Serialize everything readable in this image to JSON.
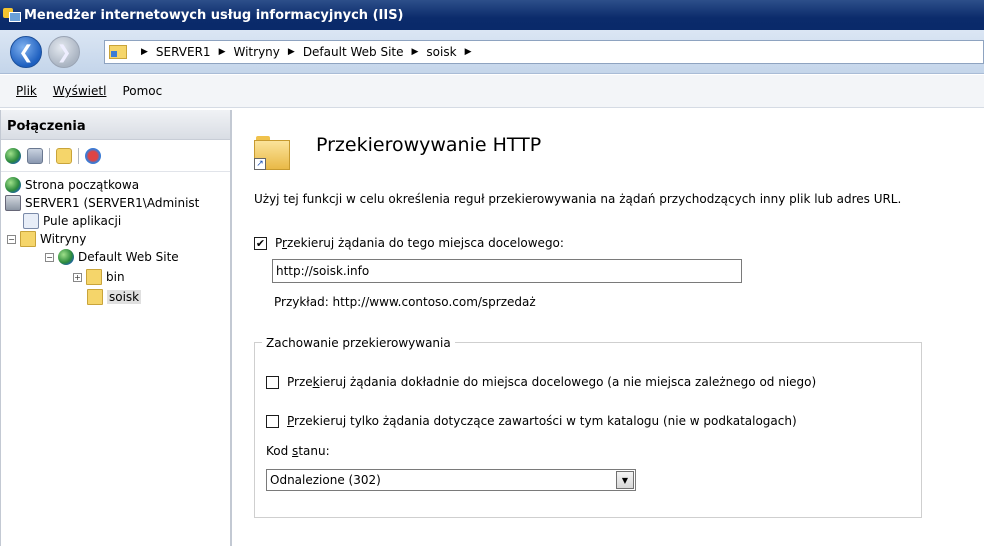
{
  "window": {
    "title": "Menedżer internetowych usług informacyjnych (IIS)",
    "icon": "iis-manager-icon"
  },
  "address": {
    "breadcrumbs": [
      "SERVER1",
      "Witryny",
      "Default Web Site",
      "soisk"
    ]
  },
  "menu": {
    "items": [
      "Plik",
      "Wyświetl",
      "Pomoc"
    ]
  },
  "connections": {
    "title": "Połączenia",
    "tree": [
      {
        "label": "Strona początkowa",
        "icon": "globe-icon"
      },
      {
        "label": "SERVER1 (SERVER1\\Administ",
        "icon": "server-icon"
      },
      {
        "label": "Pule aplikacji",
        "icon": "application-pool-icon"
      },
      {
        "label": "Witryny",
        "icon": "folder-icon"
      },
      {
        "label": "Default Web Site",
        "icon": "globe-icon"
      },
      {
        "label": "bin",
        "icon": "folder-icon"
      },
      {
        "label": "soisk",
        "icon": "folder-shortcut-icon",
        "selected": true
      }
    ]
  },
  "feature": {
    "title": "Przekierowywanie HTTP",
    "description": "Użyj tej funkcji w celu określenia reguł przekierowywania na żądań przychodzących inny plik lub adres URL.",
    "redirect_checkbox": {
      "checked": true,
      "label_pre": "P",
      "label_u": "r",
      "label_post": "zekieruj żądania do tego miejsca docelowego:"
    },
    "destination_value": "http://soisk.info",
    "example": "Przykład: http://www.contoso.com/sprzedaż",
    "behavior_group": "Zachowanie przekierowywania",
    "exact_checkbox": {
      "checked": false,
      "label_pre": "Prze",
      "label_u": "k",
      "label_post": "ieruj żądania dokładnie do miejsca docelowego (a nie miejsca zależnego od niego)"
    },
    "only_dir_checkbox": {
      "checked": false,
      "label_pre": "",
      "label_u": "P",
      "label_post": "rzekieruj tylko żądania dotyczące zawartości w tym katalogu (nie w podkatalogach)"
    },
    "status_label_pre": "Kod ",
    "status_label_u": "s",
    "status_label_post": "tanu:",
    "status_value": "Odnalezione (302)"
  }
}
